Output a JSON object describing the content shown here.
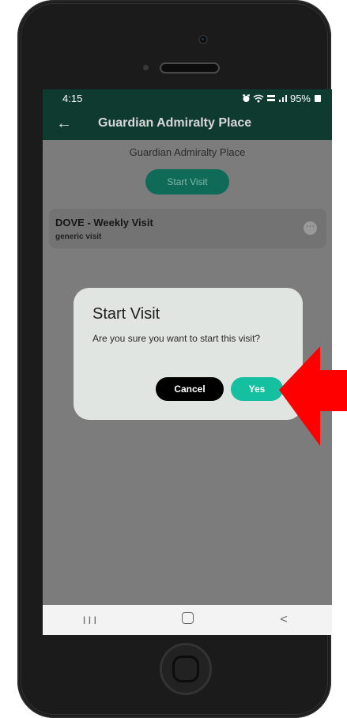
{
  "status_bar": {
    "time": "4:15",
    "icons": [
      "alarm-icon",
      "wifi-icon",
      "volte-icon",
      "signal-icon"
    ],
    "battery": "95%"
  },
  "app_bar": {
    "title": "Guardian Admiralty Place",
    "back_icon": "arrow-left-icon"
  },
  "main": {
    "location_name": "Guardian Admiralty Place",
    "start_visit_label": "Start Visit",
    "visit_card": {
      "title": "DOVE - Weekly Visit",
      "subtitle": "generic visit",
      "more_icon": "more-horizontal-icon"
    }
  },
  "dialog": {
    "title": "Start Visit",
    "message": "Are you sure you want to start this visit?",
    "cancel_label": "Cancel",
    "confirm_label": "Yes"
  },
  "nav_bar": {
    "recent_icon": "III",
    "home_icon": "home-icon",
    "back_icon": "<"
  },
  "colors": {
    "header": "#0f3a30",
    "accent": "#14c0a0",
    "dialog_bg": "#e0e5e1",
    "annotation_arrow": "#ff0000"
  }
}
